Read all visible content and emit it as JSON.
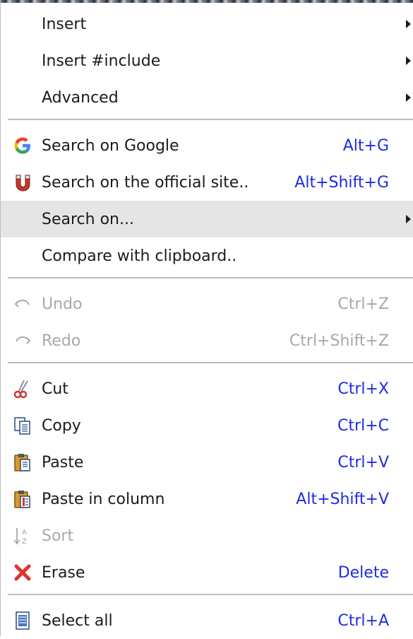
{
  "menu": {
    "insert": {
      "label": "Insert"
    },
    "insert_include": {
      "label": "Insert #include"
    },
    "advanced": {
      "label": "Advanced"
    },
    "search_google": {
      "label": "Search on Google",
      "shortcut": "Alt+G",
      "icon": "google-icon"
    },
    "search_official": {
      "label": "Search on the official site..",
      "shortcut": "Alt+Shift+G",
      "icon": "magnet-icon"
    },
    "search_on": {
      "label": "Search on..."
    },
    "compare_clipboard": {
      "label": "Compare with clipboard.."
    },
    "undo": {
      "label": "Undo",
      "shortcut": "Ctrl+Z",
      "icon": "undo-icon"
    },
    "redo": {
      "label": "Redo",
      "shortcut": "Ctrl+Shift+Z",
      "icon": "redo-icon"
    },
    "cut": {
      "label": "Cut",
      "shortcut": "Ctrl+X",
      "icon": "scissors-icon"
    },
    "copy": {
      "label": "Copy",
      "shortcut": "Ctrl+C",
      "icon": "copy-icon"
    },
    "paste": {
      "label": "Paste",
      "shortcut": "Ctrl+V",
      "icon": "paste-icon"
    },
    "paste_column": {
      "label": "Paste in column",
      "shortcut": "Alt+Shift+V",
      "icon": "paste-column-icon"
    },
    "sort": {
      "label": "Sort",
      "icon": "sort-az-icon"
    },
    "erase": {
      "label": "Erase",
      "shortcut": "Delete",
      "icon": "red-x-icon"
    },
    "select_all": {
      "label": "Select all",
      "shortcut": "Ctrl+A",
      "icon": "select-all-icon"
    }
  },
  "colors": {
    "shortcut": "#1f2be0",
    "disabled": "#a8a8a8",
    "hover_bg": "#e5e5e5",
    "separator": "#bdbdbd"
  }
}
